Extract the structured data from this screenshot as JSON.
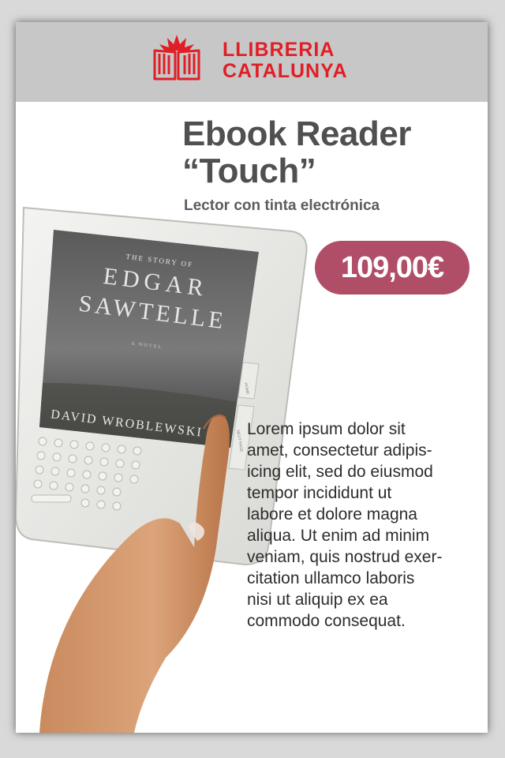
{
  "brand": {
    "line1": "LLIBRERIA",
    "line2": "CATALUNYA",
    "color": "#e01e25"
  },
  "product": {
    "title_line1": "Ebook Reader",
    "title_line2": "“Touch”",
    "subtitle": "Lector con tinta electrónica",
    "price": "109,00€",
    "price_color": "#b04e68",
    "description": "Lorem ipsum dolor sit\namet, consectetur adipis-\nicing elit, sed do eiusmod\ntempor incididunt ut\nlabore et dolore magna\naliqua. Ut enim ad minim\nveniam, quis nostrud exer-\ncitation ullamco laboris\nnisi ut aliquip ex ea\ncommodo consequat."
  },
  "device": {
    "book_line1": "THE STORY OF",
    "book_line2": "EDGAR",
    "book_line3": "SAWTELLE",
    "book_line4": "A NOVEL",
    "book_author": "DAVID WROBLEWSKI",
    "button_home": "HOME",
    "button_next": "NEXT PAGE"
  }
}
